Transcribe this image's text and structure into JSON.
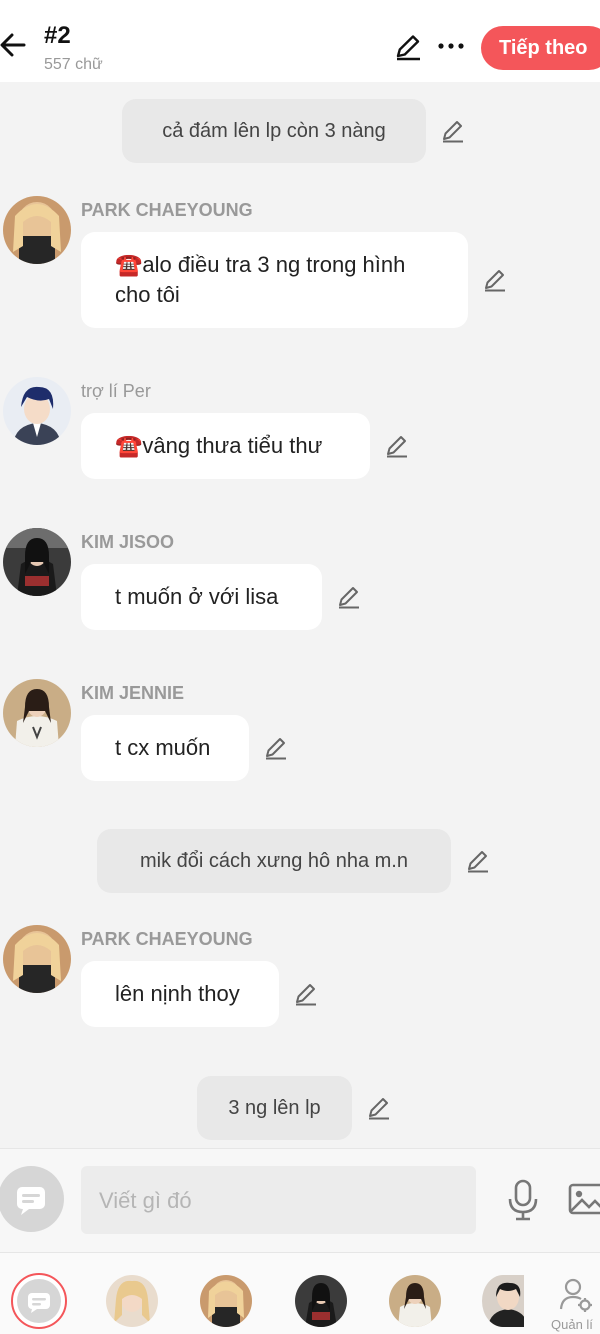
{
  "header": {
    "title": "#2",
    "word_count": "557 chữ",
    "next_label": "Tiếp theo"
  },
  "messages": [
    {
      "kind": "narration",
      "text": "cả đám lên lp còn 3 nàng"
    },
    {
      "kind": "character",
      "name": "PARK CHAEYOUNG",
      "line1": "☎️alo điều tra 3 ng trong hình",
      "line2": "cho tôi"
    },
    {
      "kind": "character",
      "name": "trợ lí Per",
      "text": "☎️vâng thưa tiểu thư"
    },
    {
      "kind": "character",
      "name": "KIM JISOO",
      "text": "t muốn ở với lisa"
    },
    {
      "kind": "character",
      "name": "KIM JENNIE",
      "text": "t cx muốn"
    },
    {
      "kind": "narration",
      "text": "mik đổi cách xưng hô nha m.n"
    },
    {
      "kind": "character",
      "name": "PARK CHAEYOUNG",
      "text": "lên nịnh thoy"
    },
    {
      "kind": "narration",
      "text": "3 ng lên lp"
    }
  ],
  "input": {
    "placeholder": "Viết gì đó"
  },
  "bottom": {
    "manage_label": "Quản lí"
  },
  "colors": {
    "accent": "#f4565a",
    "background": "#f3f3f3",
    "narration_bg": "#e8e8e8",
    "bubble_bg": "#ffffff",
    "name_gray": "#999999"
  },
  "icons": [
    "back-arrow-icon",
    "pencil-icon",
    "more-icon",
    "compose-icon",
    "microphone-icon",
    "image-icon",
    "manage-user-icon"
  ]
}
